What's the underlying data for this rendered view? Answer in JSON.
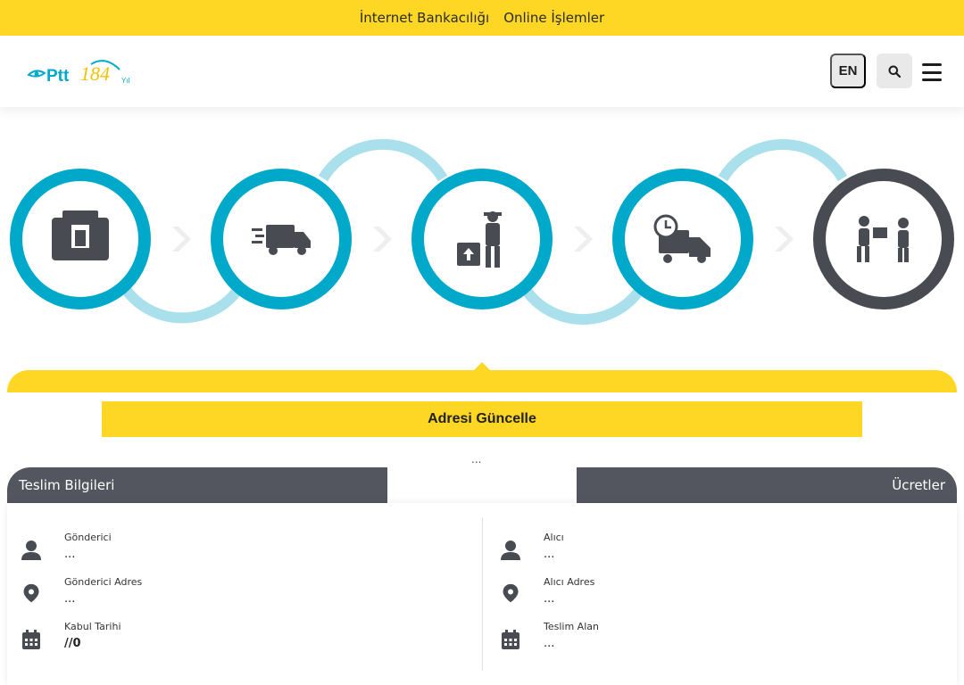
{
  "topbar": {
    "links": [
      "İnternet Bankacılığı",
      "Online İşlemler"
    ]
  },
  "header": {
    "logo_text": "Ptt 184",
    "language_button": "EN",
    "icons": {
      "search": "search-icon",
      "menu": "hamburger-menu-icon"
    }
  },
  "process": {
    "steps": [
      {
        "icon": "mailbox-icon",
        "ring_color": "#00a9c9"
      },
      {
        "icon": "delivery-truck-icon",
        "ring_color": "#00a9c9"
      },
      {
        "icon": "courier-package-icon",
        "ring_color": "#00a9c9"
      },
      {
        "icon": "scheduled-truck-icon",
        "ring_color": "#00a9c9"
      },
      {
        "icon": "handover-icon",
        "ring_color": "#484b52"
      }
    ]
  },
  "actions": {
    "update_address": "Adresi Güncelle"
  },
  "middle_placeholder": "...",
  "tabs": {
    "left": "Teslim Bilgileri",
    "right": "Ücretler"
  },
  "sender": [
    {
      "icon": "person-icon",
      "label": "Gönderici",
      "value": "..."
    },
    {
      "icon": "location-pin-icon",
      "label": "Gönderici Adres",
      "value": "..."
    },
    {
      "icon": "calendar-icon",
      "label": "Kabul Tarihi",
      "value": "//0"
    }
  ],
  "receiver": [
    {
      "icon": "person-icon",
      "label": "Alıcı",
      "value": "..."
    },
    {
      "icon": "location-pin-icon",
      "label": "Alıcı Adres",
      "value": "..."
    },
    {
      "icon": "calendar-icon",
      "label": "Teslim Alan",
      "value": "..."
    }
  ],
  "colors": {
    "brand_yellow": "#fdd724",
    "ring_blue": "#00a9c9",
    "ring_light": "#a9e0ec",
    "tab_dark": "#53565e"
  }
}
